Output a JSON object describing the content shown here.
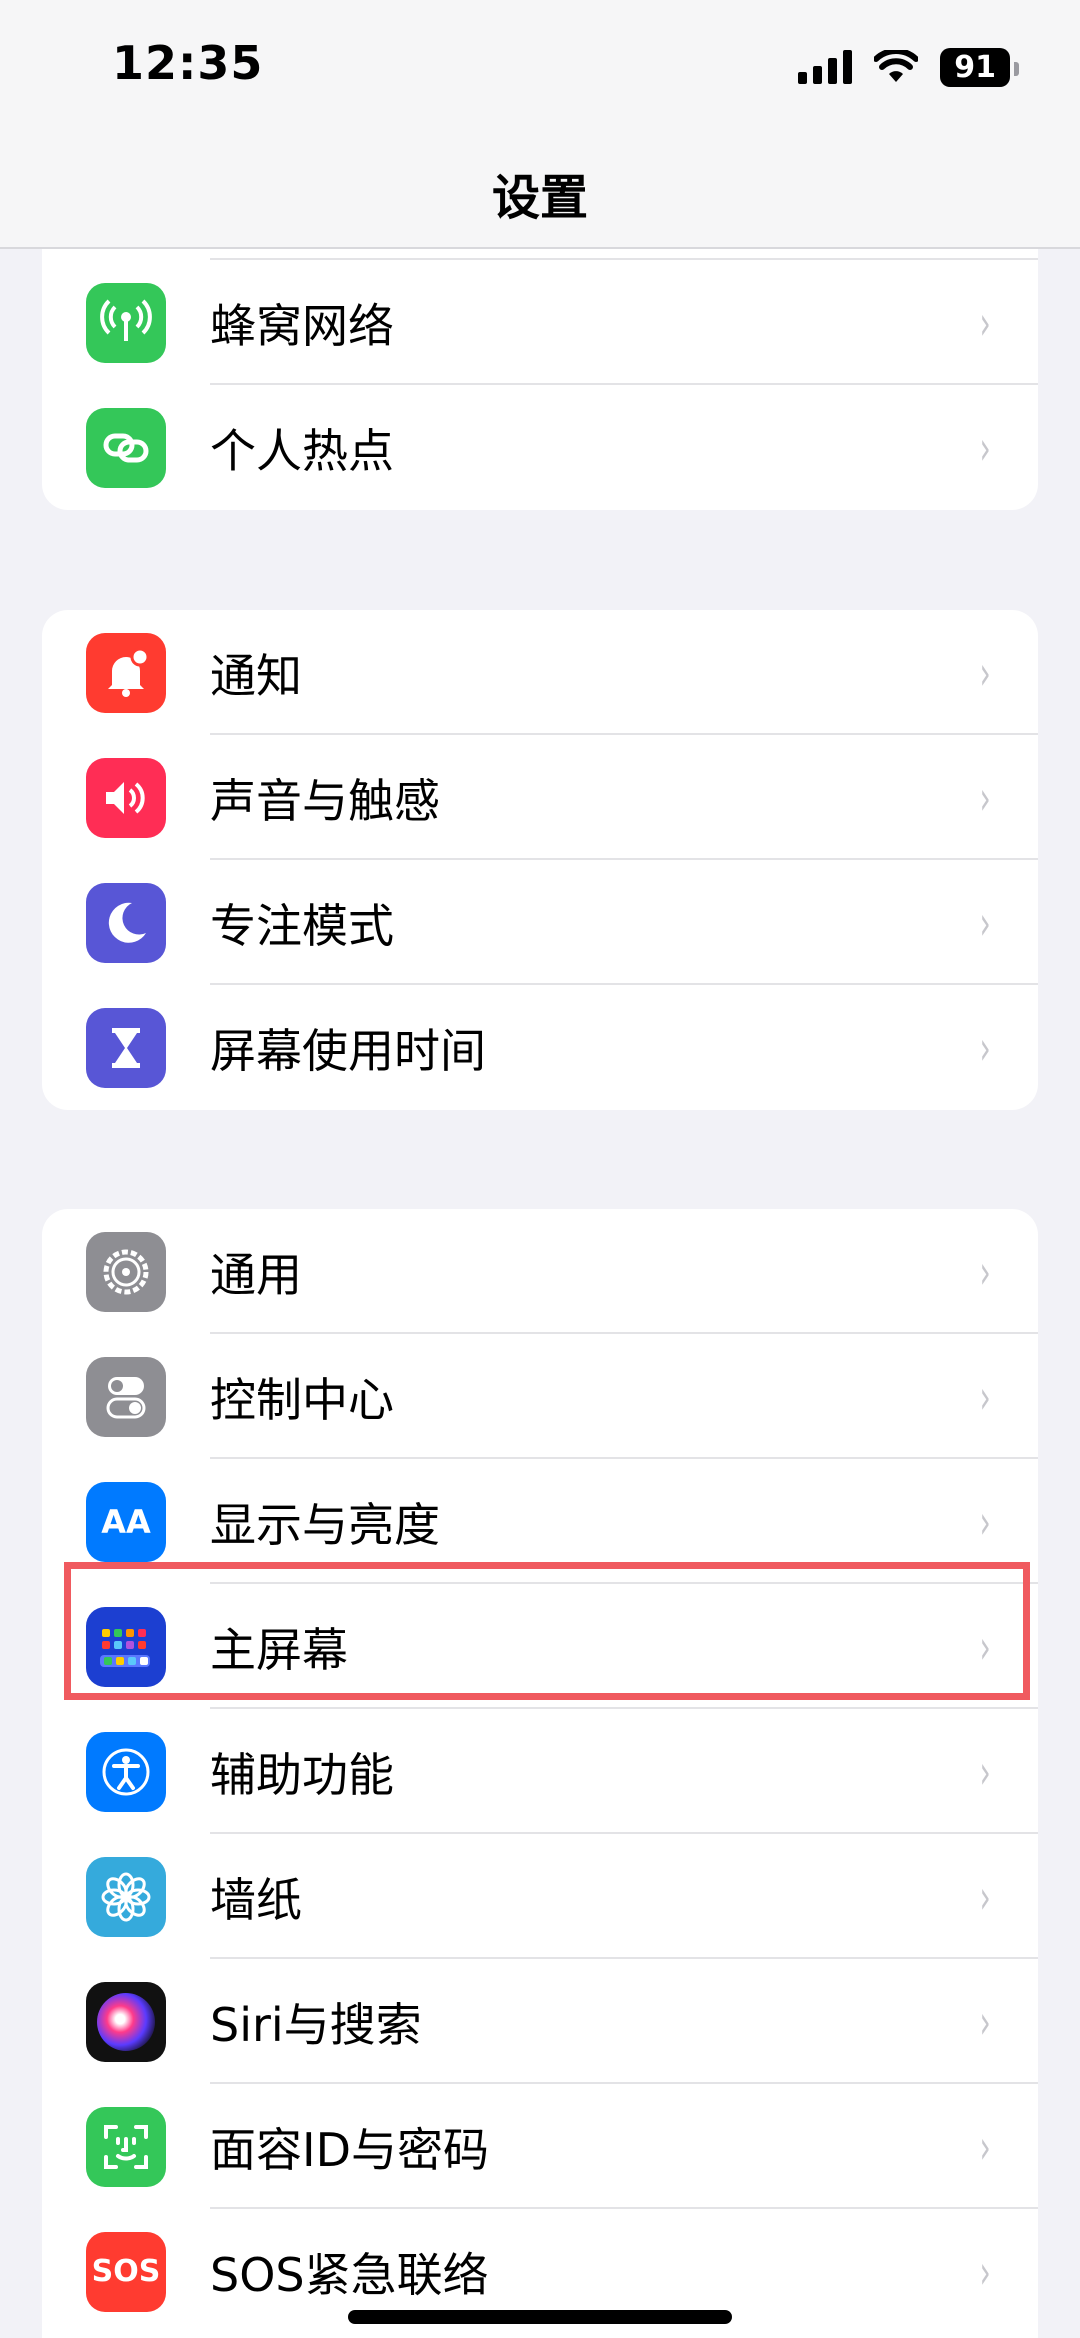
{
  "status_bar": {
    "time": "12:35",
    "battery": "91"
  },
  "nav": {
    "title": "设置"
  },
  "groups": [
    {
      "items": [
        {
          "label": "蜂窝网络",
          "icon": "cellular-antenna-icon",
          "color": "#34c759"
        },
        {
          "label": "个人热点",
          "icon": "hotspot-link-icon",
          "color": "#34c759"
        }
      ]
    },
    {
      "items": [
        {
          "label": "通知",
          "icon": "bell-icon",
          "color": "#ff3b30"
        },
        {
          "label": "声音与触感",
          "icon": "speaker-icon",
          "color": "#ff2d55"
        },
        {
          "label": "专注模式",
          "icon": "moon-icon",
          "color": "#5856d6"
        },
        {
          "label": "屏幕使用时间",
          "icon": "hourglass-icon",
          "color": "#5856d6"
        }
      ]
    },
    {
      "items": [
        {
          "label": "通用",
          "icon": "gear-icon",
          "color": "#8e8e93"
        },
        {
          "label": "控制中心",
          "icon": "toggles-icon",
          "color": "#8e8e93"
        },
        {
          "label": "显示与亮度",
          "icon": "text-size-icon",
          "color": "#007aff",
          "icon_text": "AA"
        },
        {
          "label": "主屏幕",
          "icon": "home-screen-grid-icon",
          "color": "#1c3fd1"
        },
        {
          "label": "辅助功能",
          "icon": "accessibility-icon",
          "color": "#007aff"
        },
        {
          "label": "墙纸",
          "icon": "flower-icon",
          "color": "#35aadc"
        },
        {
          "label": "Siri与搜索",
          "icon": "siri-orb-icon",
          "color": "#1a1a2e"
        },
        {
          "label": "面容ID与密码",
          "icon": "face-id-icon",
          "color": "#34c759"
        },
        {
          "label": "SOS紧急联络",
          "icon": "sos-icon",
          "color": "#ff3b30",
          "icon_text": "SOS"
        }
      ]
    }
  ],
  "chevron": "›"
}
